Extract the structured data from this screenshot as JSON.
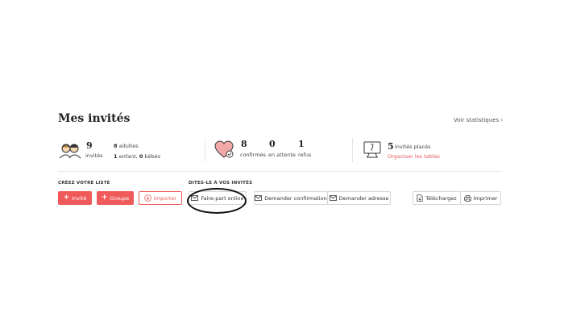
{
  "header": {
    "title": "Mes invités",
    "stats_link": "Voir statistiques",
    "stats_chevron": "›"
  },
  "guests": {
    "count": "9",
    "count_label": "invités",
    "adults_count": "8",
    "adults_label": "adultes",
    "children_count": "1",
    "children_label": "enfant,",
    "babies_count": "0",
    "babies_label": "bébés"
  },
  "rsvp": {
    "confirmed": "8",
    "confirmed_label": "confirmés",
    "pending": "0",
    "pending_label": "en attente",
    "refused": "1",
    "refused_label": "refus"
  },
  "tables": {
    "placed_count": "5",
    "placed_label": "invités placés",
    "organize_link": "Organiser les tables"
  },
  "create_list": {
    "label": "CRÉEZ VOTRE LISTE",
    "invite_button": "Invité",
    "group_button": "Groupe",
    "import_button": "Importer"
  },
  "tell_guests": {
    "label": "DITES-LE À VOS INVITÉS",
    "online_card_button": "Faire-part online",
    "request_confirmation_button": "Demander confirmation",
    "request_address_button": "Demander adresse"
  },
  "export": {
    "download_button": "Téléchargez",
    "print_button": "Imprimer"
  },
  "colors": {
    "accent": "#ef5b5b",
    "heart": "#f2a9a9"
  },
  "icons": [
    "people-icon",
    "heart-check-icon",
    "table-monitor-icon",
    "plus-icon",
    "download-circle-icon",
    "envelope-icon",
    "file-download-icon",
    "printer-icon"
  ]
}
